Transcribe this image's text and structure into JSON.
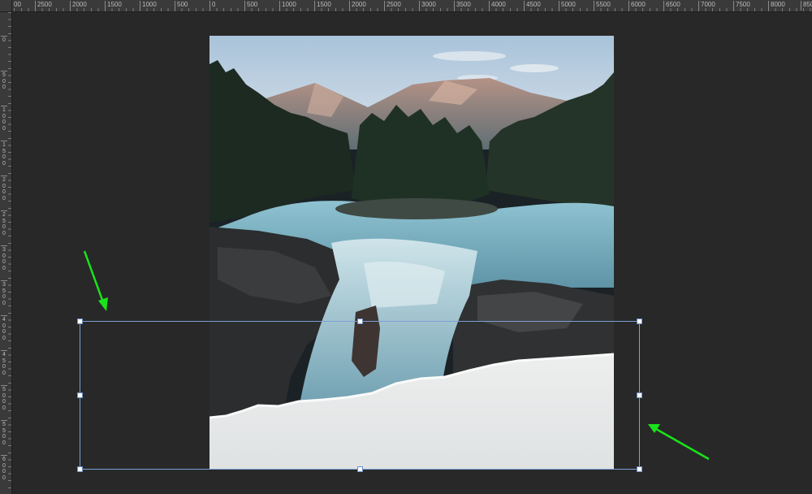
{
  "app": "Photoshop-style canvas",
  "ruler_top": {
    "labels": [
      "00",
      "2500",
      "2000",
      "1500",
      "1000",
      "500",
      "0",
      "500",
      "1000",
      "1500",
      "2000",
      "2500",
      "3000",
      "3500",
      "4000",
      "4500",
      "5000",
      "5500",
      "6000",
      "6500",
      "7000",
      "7500",
      "8000",
      "850"
    ]
  },
  "ruler_left": {
    "labels": [
      "0",
      "5\n0\n0",
      "1\n0\n0\n0",
      "1\n5\n0\n0",
      "2\n0\n0\n0",
      "2\n5\n0\n0",
      "3\n0\n0\n0",
      "3\n5\n0\n0",
      "4\n0\n0\n0",
      "4\n5\n0\n0",
      "5\n0\n0\n0",
      "5\n5\n0\n0",
      "6\n0\n0\n0"
    ]
  },
  "document": {
    "image": "waterfall-landscape",
    "content": "river waterfall with forested island and mountains, torn paper edge at bottom"
  },
  "transform": {
    "selection": "free-transform-bounding-box",
    "handles": [
      "top-left",
      "top-middle",
      "top-right",
      "middle-left",
      "middle-right",
      "bottom-left",
      "bottom-middle",
      "bottom-right"
    ]
  },
  "annotations": {
    "arrow_color": "#19e41a",
    "arrows": [
      "arrow-pointing-top-left-corner",
      "arrow-pointing-right-edge"
    ]
  },
  "colors": {
    "background": "#282828",
    "ruler": "#3a3a3a",
    "selection": "#7d9fd6",
    "paper": "#e8eaea"
  }
}
